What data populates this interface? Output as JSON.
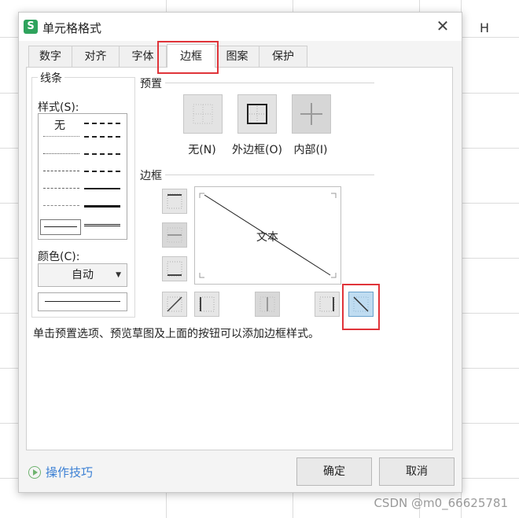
{
  "spreadsheet": {
    "column_header": "H",
    "watermark": "CSDN @m0_66625781"
  },
  "dialog": {
    "app_icon": "S",
    "title": "单元格格式",
    "close_glyph": "✕",
    "tabs": [
      {
        "label": "数字"
      },
      {
        "label": "对齐"
      },
      {
        "label": "字体"
      },
      {
        "label": "边框"
      },
      {
        "label": "图案"
      },
      {
        "label": "保护"
      }
    ],
    "active_tab": "边框",
    "line_group": {
      "title": "线条",
      "style_label": "样式(S):",
      "none_style": "无",
      "color_label": "颜色(C):",
      "color_value": "自动",
      "dropdown_glyph": "▼"
    },
    "presets": {
      "title": "预置",
      "items": [
        {
          "label": "无(N)"
        },
        {
          "label": "外边框(O)"
        },
        {
          "label": "内部(I)"
        }
      ]
    },
    "border": {
      "title": "边框",
      "preview_text": "文本"
    },
    "hint": "单击预置选项、预览草图及上面的按钮可以添加边框样式。",
    "footer": {
      "tips": "操作技巧",
      "ok": "确定",
      "cancel": "取消"
    },
    "colors": {
      "highlight": "#e0343a",
      "link": "#3a7fd4",
      "pressed": "#bfdcf1"
    }
  }
}
